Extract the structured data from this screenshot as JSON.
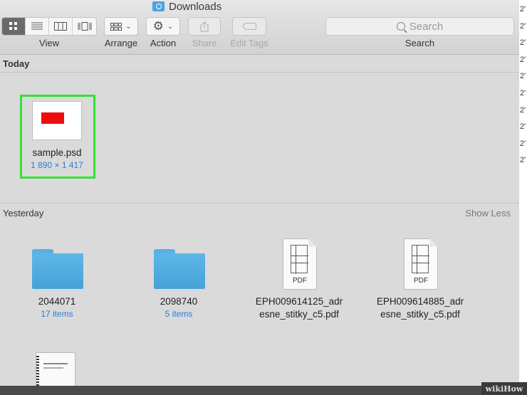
{
  "window": {
    "title": "Downloads"
  },
  "toolbar": {
    "view_label": "View",
    "arrange_label": "Arrange",
    "action_label": "Action",
    "share_label": "Share",
    "edit_tags_label": "Edit Tags",
    "search_placeholder": "Search",
    "search_label": "Search"
  },
  "sections": {
    "today": {
      "title": "Today"
    },
    "yesterday": {
      "title": "Yesterday",
      "show_less": "Show Less"
    }
  },
  "today_items": [
    {
      "name": "sample.psd",
      "sub": "1 890 × 1 417",
      "icon": "psd-thumbnail"
    }
  ],
  "yesterday_items": [
    {
      "name": "2044071",
      "sub": "17 items",
      "icon": "folder-icon"
    },
    {
      "name": "2098740",
      "sub": "5 items",
      "icon": "folder-icon"
    },
    {
      "name_l1": "EPH009614125_adr",
      "name_l2": "esne_stitky_c5.pdf",
      "icon": "pdf-icon",
      "badge": "PDF"
    },
    {
      "name_l1": "EPH009614885_adr",
      "name_l2": "esne_stitky_c5.pdf",
      "icon": "pdf-icon",
      "badge": "PDF"
    }
  ],
  "right_strip": [
    "2'",
    "2'",
    "2'",
    "2'",
    "2'",
    "2'",
    "2'",
    "2'",
    "2'",
    "2'"
  ],
  "watermark": {
    "text": "wikiHow"
  },
  "colors": {
    "selection": "#35e035",
    "folder": "#5ab0e2",
    "link": "#2f7bd6"
  }
}
